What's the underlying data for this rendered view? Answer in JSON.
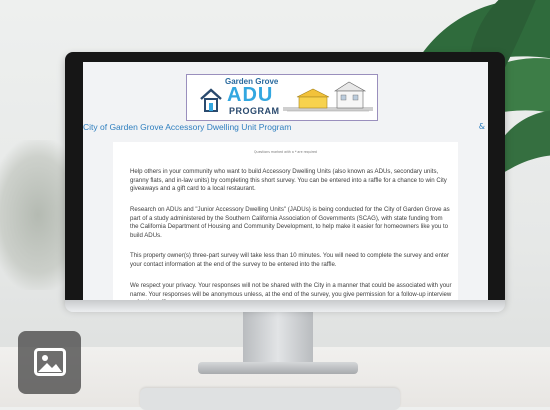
{
  "survey": {
    "logo": {
      "line1": "Garden Grove",
      "line2": "ADU",
      "line3": "PROGRAM"
    },
    "title": "City of Garden Grove Accessory Dwelling Unit Program",
    "header_link": "&",
    "required_note": "Questions marked with a * are required",
    "paragraphs": [
      "Help others in your community who want to build Accessory Dwelling Units (also known as ADUs, secondary units, granny flats, and in-law units) by completing this short survey. You can be entered into a raffle for a chance to win City giveaways and a gift card to a local restaurant.",
      "Research on ADUs and \"Junior Accessory Dwelling Units\" (JADUs) is being conducted for the City of Garden Grove as part of a study administered by the Southern California Association of Governments (SCAG), with state funding from the California Department of Housing and Community Development, to help make it easier for homeowners like you to build ADUs.",
      "This property owner(s) three-part survey will take less than 10 minutes. You will need to complete the survey and enter your contact information at the end of the survey to be entered into the raffle.",
      "We respect your privacy. Your responses will not be shared with the City in a manner that could be associated with your name. Your responses will be anonymous unless, at the end of the survey, you give permission for a follow-up interview or for the raffle."
    ]
  },
  "overlay": {
    "icon": "image-icon"
  }
}
